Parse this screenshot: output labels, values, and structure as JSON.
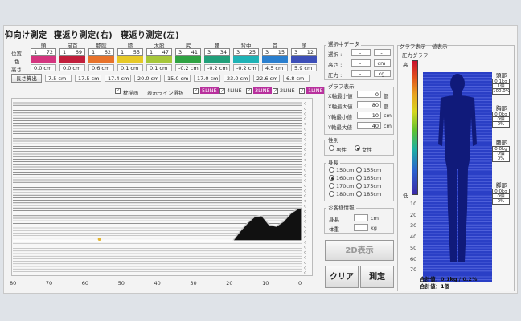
{
  "tabs": [
    "仰向け測定",
    "寝返り測定(右)",
    "寝返り測定(左)"
  ],
  "rows": {
    "position": "位置",
    "color": "色",
    "height": "高さ"
  },
  "segments": [
    {
      "name": "頭",
      "range_a": "1",
      "range_b": "72",
      "color": "#d4357f",
      "height": "0.0",
      "unit": "cm"
    },
    {
      "name": "足首",
      "range_a": "1",
      "range_b": "69",
      "color": "#c21f3c",
      "height": "0.0",
      "unit": "cm"
    },
    {
      "name": "膝腔",
      "range_a": "1",
      "range_b": "62",
      "color": "#e8732b",
      "height": "0.6",
      "unit": "cm"
    },
    {
      "name": "膝",
      "range_a": "1",
      "range_b": "55",
      "color": "#e6c927",
      "height": "0.1",
      "unit": "cm"
    },
    {
      "name": "太股",
      "range_a": "1",
      "range_b": "47",
      "color": "#a6c73a",
      "height": "0.1",
      "unit": "cm"
    },
    {
      "name": "尻",
      "range_a": "3",
      "range_b": "41",
      "color": "#2fa343",
      "height": "-0.2",
      "unit": "cm"
    },
    {
      "name": "腰",
      "range_a": "3",
      "range_b": "34",
      "color": "#21a07a",
      "height": "-0.2",
      "unit": "cm"
    },
    {
      "name": "背中",
      "range_a": "3",
      "range_b": "25",
      "color": "#1fb3b6",
      "height": "-0.2",
      "unit": "cm"
    },
    {
      "name": "首",
      "range_a": "3",
      "range_b": "15",
      "color": "#2a7fcf",
      "height": "4.5",
      "unit": "cm"
    },
    {
      "name": "頭",
      "range_a": "3",
      "range_b": "12",
      "color": "#3d4fb8",
      "height": "5.9",
      "unit": "cm"
    }
  ],
  "length_calc": {
    "button": "長さ算出",
    "values": [
      "7.5 cm",
      "17.5 cm",
      "17.4 cm",
      "20.0 cm",
      "15.0 cm",
      "17.0 cm",
      "23.0 cm",
      "22.6 cm",
      "6.8 cm"
    ]
  },
  "chart_options": {
    "pillow_label": "枕描画",
    "line_select_label": "表示ライン選択",
    "lines": [
      {
        "label": "5LINE",
        "checked": true,
        "color": "#b8309d"
      },
      {
        "label": "4LINE",
        "checked": true,
        "color": ""
      },
      {
        "label": "3LINE",
        "checked": true,
        "color": "#b8309d"
      },
      {
        "label": "2LINE",
        "checked": true,
        "color": ""
      },
      {
        "label": "1LINE",
        "checked": true,
        "color": "#b8309d"
      }
    ]
  },
  "chart_data": {
    "type": "area",
    "x_ticks": [
      "80",
      "70",
      "60",
      "50",
      "40",
      "30",
      "20",
      "10",
      "0"
    ],
    "xlim": [
      80,
      0
    ],
    "grid": true,
    "baseline_line_color": "#ffffff",
    "profile": [
      {
        "x": 19,
        "y": 0
      },
      {
        "x": 17,
        "y": 0.3
      },
      {
        "x": 15,
        "y": 0.55
      },
      {
        "x": 13,
        "y": 0.75
      },
      {
        "x": 11,
        "y": 0.78
      },
      {
        "x": 9,
        "y": 0.5
      },
      {
        "x": 7,
        "y": 0.45
      },
      {
        "x": 5,
        "y": 0.6
      },
      {
        "x": 3,
        "y": 0.85
      },
      {
        "x": 1,
        "y": 1.0
      },
      {
        "x": 0,
        "y": 1.0
      }
    ]
  },
  "selected_data": {
    "title": "選択中データ",
    "rows": [
      {
        "label": "選択 :",
        "v1": "-",
        "v2": "-"
      },
      {
        "label": "高さ :",
        "v1": "-",
        "v2": "cm"
      },
      {
        "label": "圧力 :",
        "v1": "-",
        "v2": "kg"
      }
    ]
  },
  "graph_display": {
    "title": "グラフ表示",
    "rows": [
      {
        "label": "X軸最小値",
        "value": "0",
        "unit": "個"
      },
      {
        "label": "X軸最大値",
        "value": "80",
        "unit": "個"
      },
      {
        "label": "Y軸最小値",
        "value": "-10",
        "unit": "cm"
      },
      {
        "label": "Y軸最大値",
        "value": "40",
        "unit": "cm"
      }
    ]
  },
  "gender": {
    "title": "性別",
    "male": "男性",
    "female": "女性",
    "selected": "female"
  },
  "height_group": {
    "title": "身長",
    "options": [
      "150cm",
      "155cm",
      "160cm",
      "165cm",
      "170cm",
      "175cm",
      "180cm",
      "185cm"
    ],
    "selected": "160cm"
  },
  "customer": {
    "title": "お客様情報",
    "height_label": "身長",
    "height_unit": "cm",
    "weight_label": "体重",
    "weight_unit": "kg"
  },
  "buttons": {
    "show_2d": "2D表示",
    "clear": "クリア",
    "measure": "測定"
  },
  "graph_tabs": {
    "graph": "グラフ表示",
    "value": "値表示"
  },
  "pressure": {
    "title": "圧力グラフ",
    "high": "高",
    "low": "低",
    "scale": [
      "10",
      "20",
      "30",
      "40",
      "50",
      "60",
      "70"
    ],
    "regions": [
      {
        "name": "頭部",
        "v1": "0.1kg",
        "v2": "1個",
        "v3": "100.0%"
      },
      {
        "name": "胸部",
        "v1": "0.0kg",
        "v2": "0個",
        "v3": "0%"
      },
      {
        "name": "腰部",
        "v1": "0.0kg",
        "v2": "0個",
        "v3": "0%"
      },
      {
        "name": "脚部",
        "v1": "0.0kg",
        "v2": "0個",
        "v3": "0%"
      }
    ],
    "total1": "合計値：0.1kg / 0.2%",
    "total2": "合計値：1個"
  }
}
